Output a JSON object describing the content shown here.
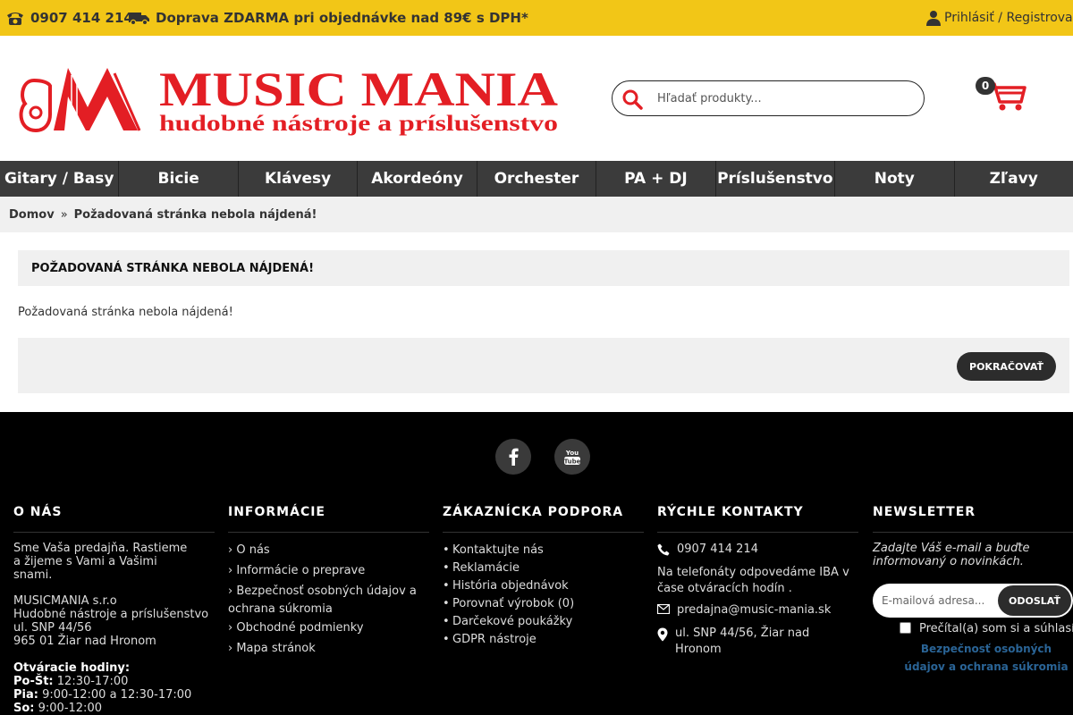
{
  "topbar": {
    "phone": "0907 414 214",
    "shipping": "Doprava ZDARMA pri objednávke nad 89€ s DPH*",
    "account": "Prihlásiť / Registrovať"
  },
  "logo": {
    "brand": "MUSIC MANIA",
    "tagline": "hudobné nástroje a príslušenstvo"
  },
  "search": {
    "placeholder": "Hľadať produkty..."
  },
  "cart": {
    "count": "0"
  },
  "nav": {
    "items": [
      "Gitary / Basy",
      "Bicie",
      "Klávesy",
      "Akordeóny",
      "Orchester",
      "PA + DJ",
      "Príslušenstvo",
      "Noty",
      "Zľavy"
    ]
  },
  "breadcrumb": {
    "home": "Domov",
    "separator": "»",
    "current": "Požadovaná stránka nebola nájdená!"
  },
  "content": {
    "heading": "POŽADOVANÁ STRÁNKA NEBOLA NÁJDENÁ!",
    "message": "Požadovaná stránka nebola nájdená!",
    "continue_label": "POKRAČOVAŤ"
  },
  "footer": {
    "about": {
      "title": "O NÁS",
      "intro": "Sme Vaša predajňa. Rastieme a žijeme s Vami a Vašimi snami.",
      "company": "MUSICMANIA s.r.o",
      "company_desc": "Hudobné nástroje a príslušenstvo",
      "street": "ul. SNP 44/56",
      "city": "965 01 Žiar nad Hronom",
      "hours_title": "Otváracie hodiny:",
      "hours": [
        {
          "day": "Po-Št:",
          "time": " 12:30-17:00"
        },
        {
          "day": "Pia:",
          "time": " 9:00-12:00 a 12:30-17:00"
        },
        {
          "day": "So:",
          "time": " 9:00-12:00"
        }
      ]
    },
    "info": {
      "title": "INFORMÁCIE",
      "links": [
        "O nás",
        "Informácie o preprave",
        "Bezpečnosť osobných údajov a ochrana súkromia",
        "Obchodné podmienky",
        "Mapa stránok"
      ]
    },
    "support": {
      "title": "ZÁKAZNÍCKA PODPORA",
      "links": [
        "Kontaktujte nás",
        "Reklamácie",
        "História objednávok",
        "Porovnať výrobok (0)",
        "Darčekové poukážky",
        "GDPR nástroje"
      ]
    },
    "contacts": {
      "title": "RÝCHLE KONTAKTY",
      "phone": "0907 414 214",
      "note": "Na telefonáty odpovedáme IBA v čase otváracích hodín .",
      "email": "predajna@music-mania.sk",
      "address": "ul. SNP 44/56, Žiar nad Hronom"
    },
    "newsletter": {
      "title": "NEWSLETTER",
      "text": "Zadajte Váš e-mail a buďte informovaný o novinkách.",
      "placeholder": "E-mailová adresa...",
      "button": "ODOSLAŤ",
      "consent": "Prečítal(a) som si a súhlasím s",
      "consent_link": "Bezpečnosť osobných údajov a ochrana súkromia"
    }
  },
  "colors": {
    "topbar": "#f2c617",
    "brand_red": "#e31e24",
    "nav_bg": "#3b3b3b",
    "footer_bg": "#000000",
    "link_blue": "#2a6496"
  }
}
